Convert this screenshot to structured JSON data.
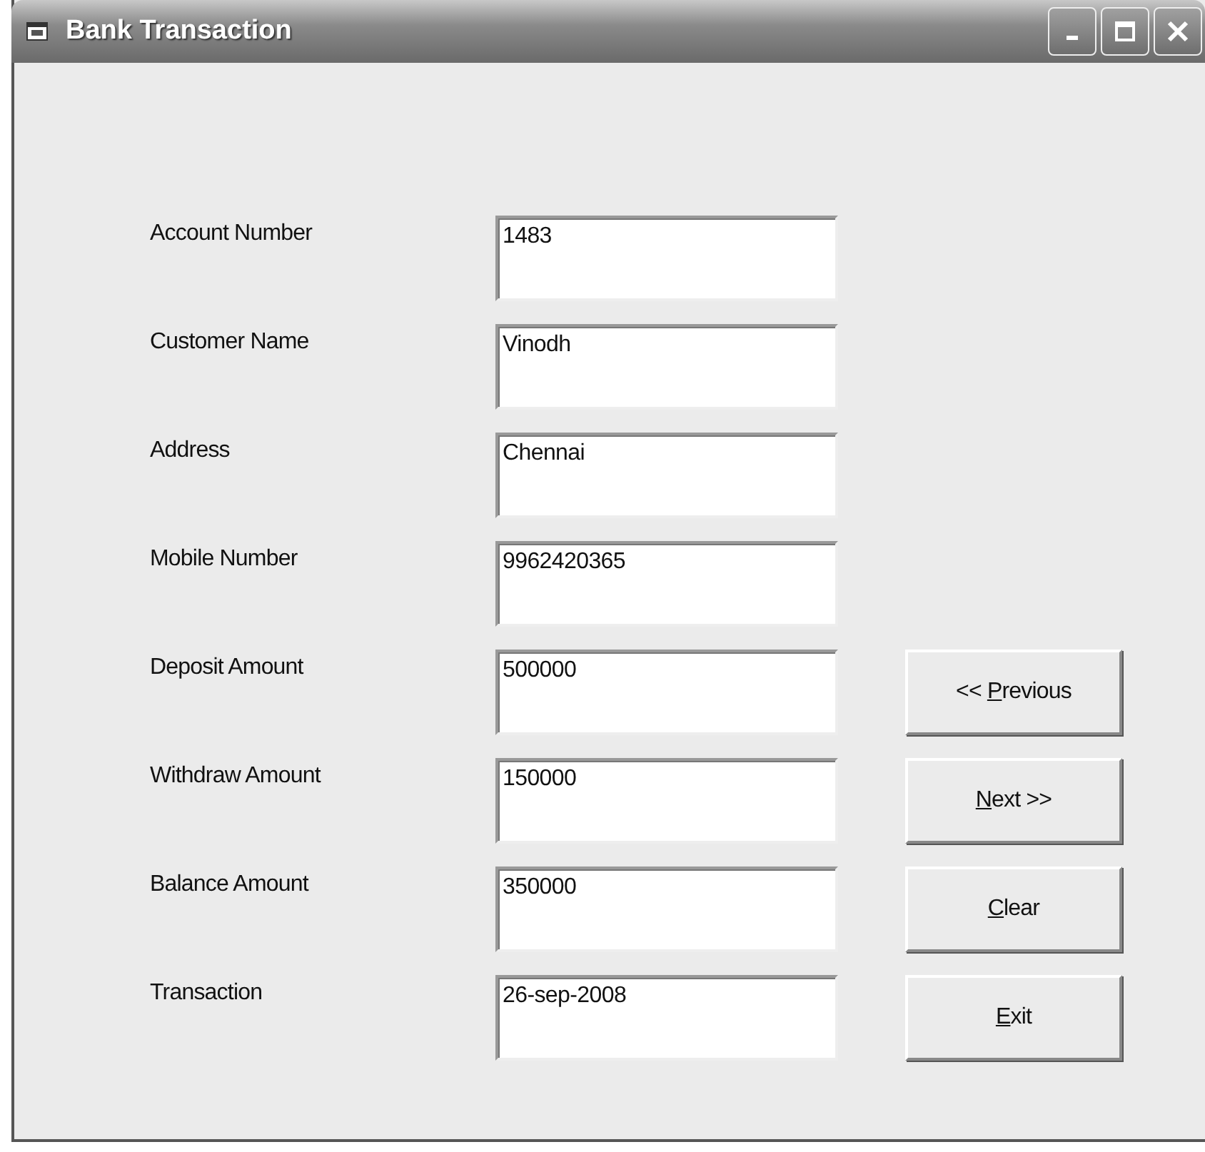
{
  "window": {
    "title": "Bank Transaction"
  },
  "fields": [
    {
      "label": "Account Number",
      "value": "1483"
    },
    {
      "label": "Customer Name",
      "value": "Vinodh"
    },
    {
      "label": "Address",
      "value": "Chennai"
    },
    {
      "label": "Mobile Number",
      "value": "9962420365"
    },
    {
      "label": "Deposit Amount",
      "value": "500000"
    },
    {
      "label": "Withdraw Amount",
      "value": "150000"
    },
    {
      "label": "Balance Amount",
      "value": "350000"
    },
    {
      "label": "Transaction",
      "value": "26-sep-2008"
    }
  ],
  "buttons": [
    {
      "before": "<< ",
      "access_key": "P",
      "after": "revious"
    },
    {
      "access_key": "N",
      "after": "ext >>"
    },
    {
      "access_key": "C",
      "after": "lear"
    },
    {
      "access_key": "E",
      "after": "xit"
    }
  ]
}
